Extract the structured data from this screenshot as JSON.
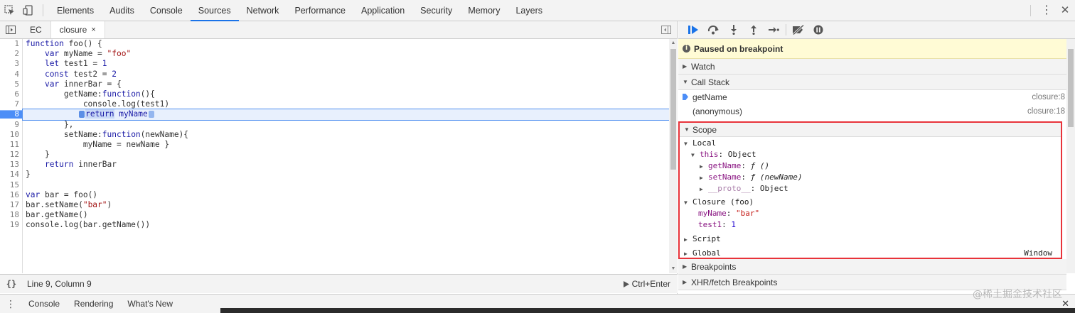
{
  "topbar": {
    "tabs": [
      "Elements",
      "Audits",
      "Console",
      "Sources",
      "Network",
      "Performance",
      "Application",
      "Security",
      "Memory",
      "Layers"
    ],
    "active_tab": "Sources",
    "kebab": "⋮",
    "close": "✕"
  },
  "source": {
    "tabs": [
      {
        "label": "EC",
        "active": false
      },
      {
        "label": "closure",
        "active": true,
        "close": "×"
      }
    ],
    "current_line": 8,
    "status_position": "Line 9, Column 9",
    "run_hint": "Ctrl+Enter",
    "braces": "{}"
  },
  "code_lines": [
    "function foo() {",
    "    var myName = \"foo\"",
    "    let test1 = 1",
    "    const test2 = 2",
    "    var innerBar = {",
    "        getName:function(){",
    "            console.log(test1)",
    "            return myName",
    "        },",
    "        setName:function(newName){",
    "            myName = newName }",
    "    }",
    "    return innerBar",
    "}",
    "",
    "var bar = foo()",
    "bar.setName(\"bar\")",
    "bar.getName()",
    "console.log(bar.getName())"
  ],
  "debugger": {
    "paused_message": "Paused on breakpoint",
    "sections": {
      "watch": "Watch",
      "call_stack": "Call Stack",
      "scope": "Scope",
      "breakpoints": "Breakpoints",
      "xhr": "XHR/fetch Breakpoints"
    },
    "call_stack": [
      {
        "name": "getName",
        "location": "closure:8",
        "current": true
      },
      {
        "name": "(anonymous)",
        "location": "closure:18",
        "current": false
      }
    ],
    "scope": {
      "local_label": "Local",
      "this_label": "this",
      "this_value": "Object",
      "getName_label": "getName",
      "getName_value": "ƒ ()",
      "setName_label": "setName",
      "setName_value": "ƒ (newName)",
      "proto_label": "__proto__",
      "proto_value": "Object",
      "closure_label": "Closure (foo)",
      "myName_label": "myName",
      "myName_value": "\"bar\"",
      "test1_label": "test1",
      "test1_value": "1",
      "script_label": "Script",
      "global_label": "Global",
      "global_value": "Window"
    }
  },
  "drawer": {
    "tabs": [
      "Console",
      "Rendering",
      "What's New"
    ],
    "close": "✕"
  },
  "watermark": "@稀土掘金技术社区",
  "colors": {
    "accent": "#1a73e8",
    "breakpoint": "#4c8ef7",
    "paused_bg": "#fffbd5",
    "scope_border": "#e8333a"
  }
}
